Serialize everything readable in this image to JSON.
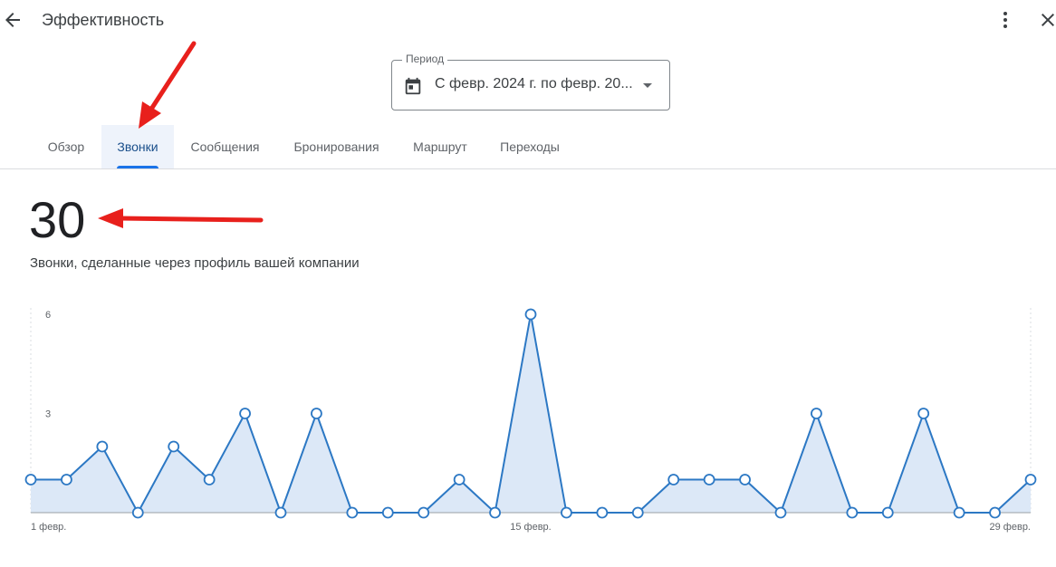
{
  "header": {
    "back_icon": "arrow-back-icon",
    "title": "Эффективность",
    "more_icon": "more-vert-icon",
    "close_icon": "close-icon"
  },
  "period": {
    "label": "Период",
    "value": "С февр. 2024 г. по февр. 20...",
    "icon": "calendar-icon",
    "dropdown_icon": "arrow-drop-down-icon"
  },
  "tabs": [
    {
      "label": "Обзор",
      "active": false
    },
    {
      "label": "Звонки",
      "active": true
    },
    {
      "label": "Сообщения",
      "active": false
    },
    {
      "label": "Бронирования",
      "active": false
    },
    {
      "label": "Маршрут",
      "active": false
    },
    {
      "label": "Переходы",
      "active": false
    }
  ],
  "summary": {
    "total": "30",
    "description": "Звонки, сделанные через профиль вашей компании"
  },
  "colors": {
    "accent": "#1a73e8",
    "active_tab_text": "#1a4f8b",
    "series_line": "#2c78c4",
    "series_fill": "#dce8f7",
    "annotation_arrow": "#e8201c"
  },
  "chart_data": {
    "type": "area",
    "x_ticks": [
      "1 февр.",
      "15 февр.",
      "29 февр."
    ],
    "y_ticks": [
      "6",
      "3"
    ],
    "ylim": [
      0,
      6
    ],
    "x": [
      1,
      2,
      3,
      4,
      5,
      6,
      7,
      8,
      9,
      10,
      11,
      12,
      13,
      14,
      15,
      16,
      17,
      18,
      19,
      20,
      21,
      22,
      23,
      24,
      25,
      26,
      27,
      28,
      29
    ],
    "values": [
      1,
      1,
      2,
      0,
      2,
      1,
      3,
      0,
      3,
      0,
      0,
      0,
      1,
      0,
      6,
      0,
      0,
      0,
      1,
      1,
      1,
      0,
      3,
      0,
      0,
      3,
      0,
      0,
      1
    ],
    "markers": true
  }
}
